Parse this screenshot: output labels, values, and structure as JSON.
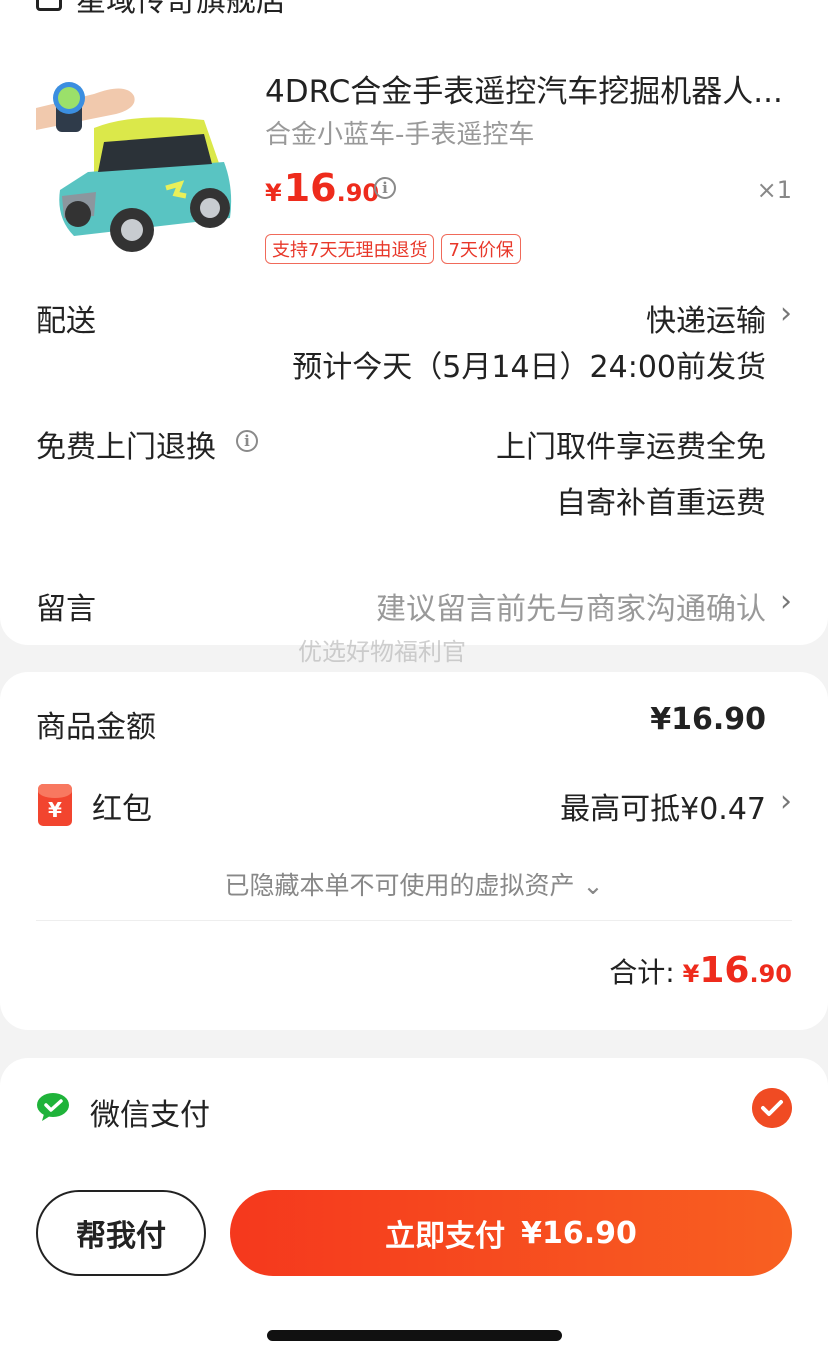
{
  "store": {
    "name": "星域传奇旗舰店"
  },
  "product": {
    "title": "4DRC合金手表遥控汽车挖掘机器人...",
    "spec": "合金小蓝车-手表遥控车",
    "price_symbol": "¥",
    "price_int": "16",
    "price_dec": ".90",
    "quantity": "×1",
    "tags": [
      "支持7天无理由退货",
      "7天价保"
    ]
  },
  "delivery": {
    "label": "配送",
    "method": "快递运输",
    "eta": "预计今天（5月14日）24:00前发货"
  },
  "return_service": {
    "label": "免费上门退换",
    "line1": "上门取件享运费全免",
    "line2": "自寄补首重运费"
  },
  "message": {
    "label": "留言",
    "placeholder": "建议留言前先与商家沟通确认"
  },
  "watermark": "优选好物福利官",
  "summary": {
    "goods_label": "商品金额",
    "goods_amount": "¥16.90",
    "redpack_label": "红包",
    "redpack_value": "最高可抵¥0.47",
    "redpack_icon_glyph": "¥",
    "hidden_note": "已隐藏本单不可使用的虚拟资产 ⌄",
    "total_label": "合计:",
    "total_symbol": "¥",
    "total_int": "16",
    "total_dec": ".90"
  },
  "payment": {
    "method": "微信支付",
    "selected": true
  },
  "actions": {
    "help_pay": "帮我付",
    "pay_now": "立即支付",
    "pay_amount": "¥16.90"
  },
  "colors": {
    "accent": "#ee2b1c",
    "pay_gradient_start": "#f5381d",
    "pay_gradient_end": "#f86021",
    "wechat_green": "#1fb33a"
  }
}
